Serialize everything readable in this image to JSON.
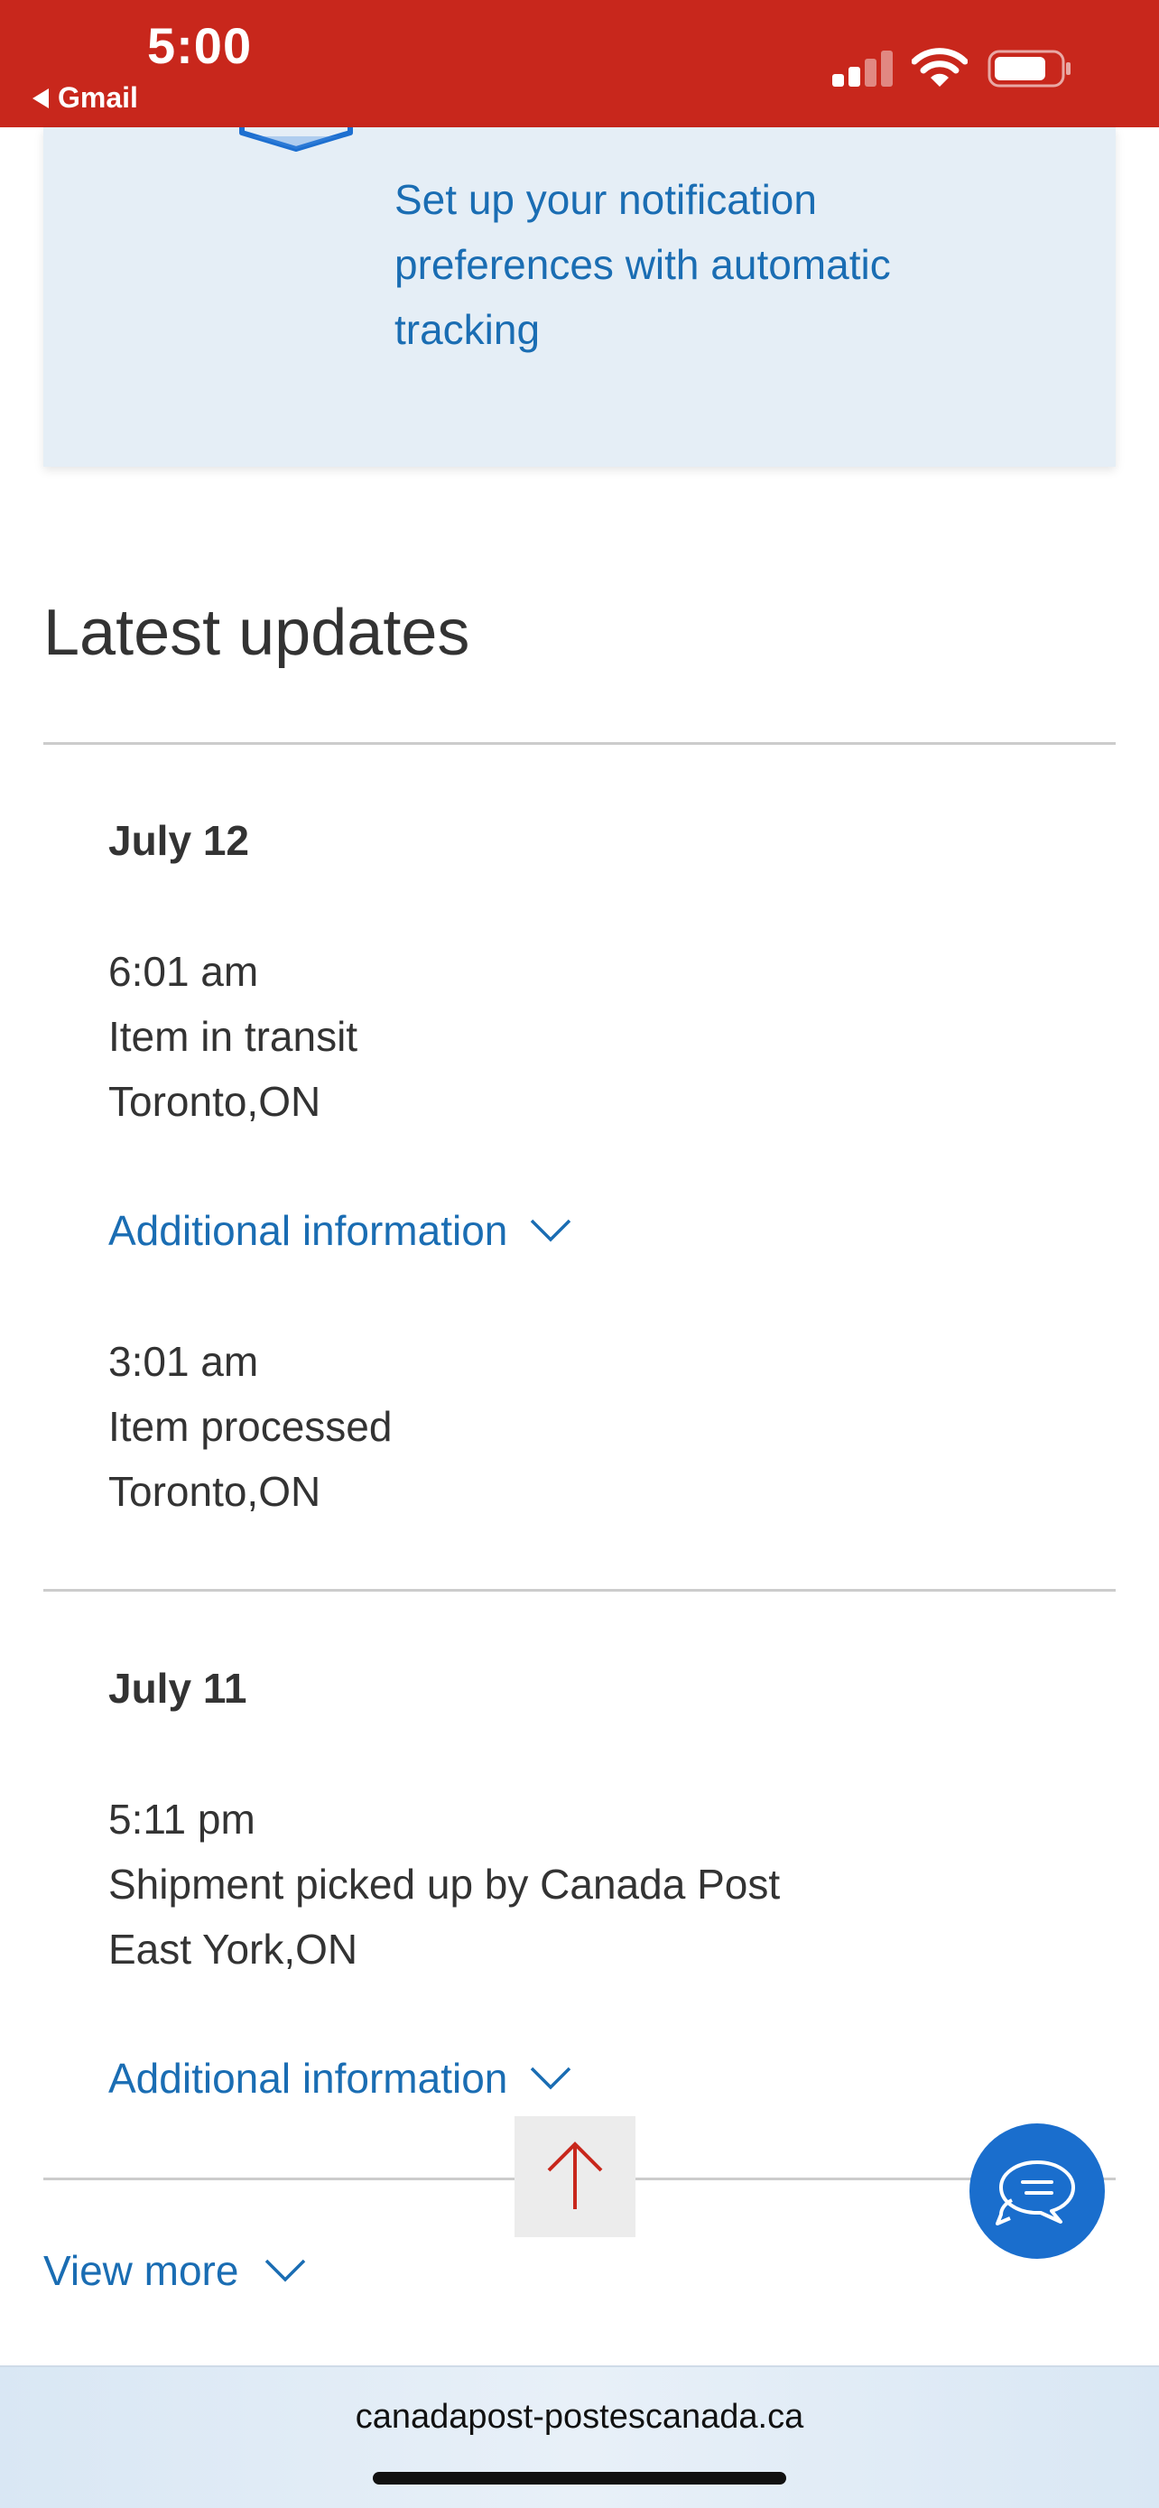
{
  "status_bar": {
    "time": "5:00",
    "back_app": "Gmail"
  },
  "notification": {
    "text": "Set up your notification preferences with automatic tracking"
  },
  "updates": {
    "title": "Latest updates",
    "days": [
      {
        "date": "July 12",
        "events": [
          {
            "time": "6:01 am",
            "status": "Item in transit",
            "location": "Toronto,ON",
            "more_info": "Additional information"
          },
          {
            "time": "3:01 am",
            "status": "Item processed",
            "location": "Toronto,ON"
          }
        ]
      },
      {
        "date": "July 11",
        "events": [
          {
            "time": "5:11 pm",
            "status": "Shipment picked up by Canada Post",
            "location": "East York,ON",
            "more_info": "Additional information"
          }
        ]
      }
    ],
    "view_more": "View more"
  },
  "browser": {
    "url": "canadapost-postescanada.ca"
  },
  "colors": {
    "brand_red": "#c8271c",
    "link_blue": "#1a6db3",
    "chat_blue": "#1a6ecd"
  },
  "icons": {
    "back": "back-triangle-icon",
    "signal": "cellular-signal-icon",
    "wifi": "wifi-icon",
    "battery": "battery-icon",
    "package": "package-icon",
    "chevron": "chevron-down-icon",
    "scroll_top": "arrow-up-icon",
    "chat": "chat-bubbles-icon"
  }
}
